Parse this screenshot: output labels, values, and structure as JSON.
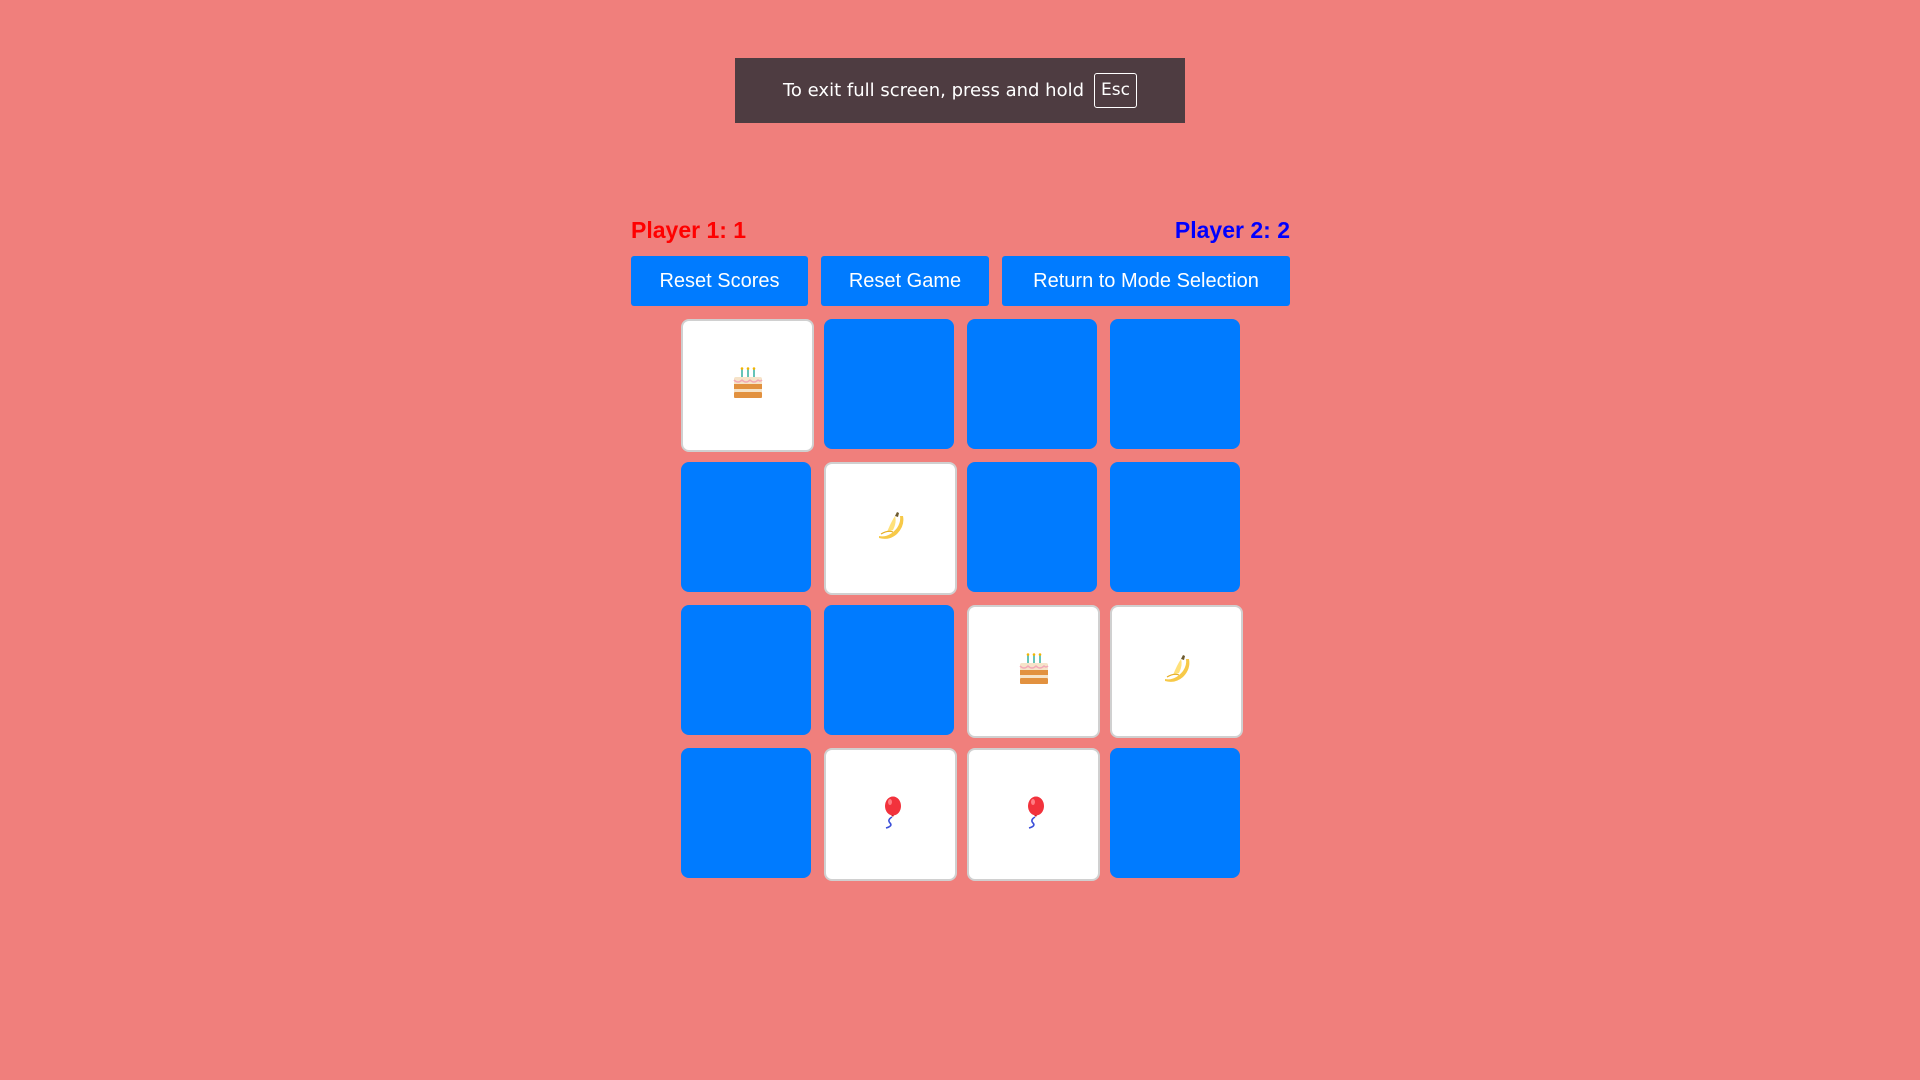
{
  "notice": {
    "message": "To exit full screen, press and hold",
    "key": "Esc"
  },
  "scores": {
    "player1": "Player 1: 1",
    "player2": "Player 2: 2"
  },
  "buttons": {
    "reset_scores": "Reset Scores",
    "reset_game": "Reset Game",
    "return_mode": "Return to Mode Selection"
  },
  "colors": {
    "background": "#f07f7c",
    "card_back": "#007bff",
    "button": "#007bff",
    "player1": "#ff0000",
    "player2": "#0000ff"
  },
  "board": {
    "rows": 4,
    "cols": 4,
    "cards": [
      {
        "state": "revealed",
        "icon": "cake-icon"
      },
      {
        "state": "hidden",
        "icon": ""
      },
      {
        "state": "hidden",
        "icon": ""
      },
      {
        "state": "hidden",
        "icon": ""
      },
      {
        "state": "hidden",
        "icon": ""
      },
      {
        "state": "revealed",
        "icon": "banana-icon"
      },
      {
        "state": "hidden",
        "icon": ""
      },
      {
        "state": "hidden",
        "icon": ""
      },
      {
        "state": "hidden",
        "icon": ""
      },
      {
        "state": "hidden",
        "icon": ""
      },
      {
        "state": "revealed",
        "icon": "cake-icon"
      },
      {
        "state": "revealed",
        "icon": "banana-icon"
      },
      {
        "state": "hidden",
        "icon": ""
      },
      {
        "state": "revealed",
        "icon": "balloon-icon"
      },
      {
        "state": "revealed",
        "icon": "balloon-icon"
      },
      {
        "state": "hidden",
        "icon": ""
      }
    ]
  }
}
